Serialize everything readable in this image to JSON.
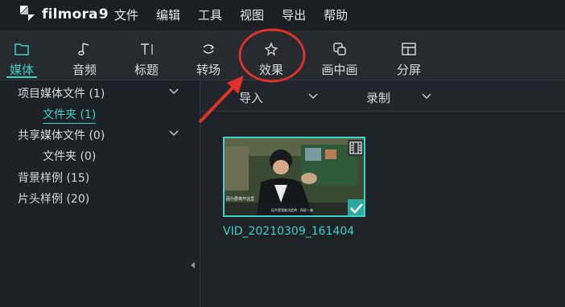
{
  "app": {
    "brand": "filmora",
    "version": "9"
  },
  "menu": [
    "文件",
    "编辑",
    "工具",
    "视图",
    "导出",
    "帮助"
  ],
  "toolbar": {
    "tabs": [
      {
        "label": "媒体",
        "icon": "folder-icon",
        "active": true
      },
      {
        "label": "音频",
        "icon": "music-note-icon",
        "active": false
      },
      {
        "label": "标题",
        "icon": "text-title-icon",
        "active": false
      },
      {
        "label": "转场",
        "icon": "transition-icon",
        "active": false
      },
      {
        "label": "效果",
        "icon": "effects-sparkle-icon",
        "active": false
      },
      {
        "label": "画中画",
        "icon": "pip-icon",
        "active": false
      },
      {
        "label": "分屏",
        "icon": "split-screen-icon",
        "active": false
      }
    ]
  },
  "sidebar": {
    "items": [
      {
        "label": "项目媒体文件 (1)"
      },
      {
        "label": "文件夹 (1)"
      },
      {
        "label": "共享媒体文件 (0)"
      },
      {
        "label": "文件夹 (0)"
      },
      {
        "label": "背景样例 (15)"
      },
      {
        "label": "片头样例 (20)"
      }
    ]
  },
  "mainbar": {
    "import_label": "导入",
    "record_label": "录制"
  },
  "media": {
    "items": [
      {
        "name": "VID_20210309_161404",
        "subtitle_line1": "因为要离开这里",
        "subtitle_line2": "但不是我能决定的 · 再说一遍"
      }
    ]
  },
  "colors": {
    "accent": "#3fd0c6",
    "annotation": "#e0312a"
  }
}
